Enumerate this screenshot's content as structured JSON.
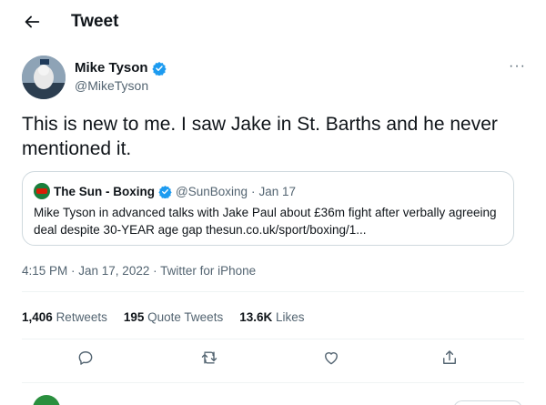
{
  "header": {
    "title": "Tweet"
  },
  "author": {
    "name": "Mike Tyson",
    "handle": "@MikeTyson"
  },
  "tweet": {
    "text": "This is new to me. I saw Jake in St. Barths and he never mentioned it."
  },
  "quote": {
    "name": "The Sun - Boxing",
    "handle": "@SunBoxing",
    "dot": "·",
    "date": "Jan 17",
    "body": "Mike Tyson in advanced talks with Jake Paul about £36m fight after verbally agreeing deal despite 30-YEAR age gap thesun.co.uk/sport/boxing/1..."
  },
  "meta": {
    "time": "4:15 PM · Jan 17, 2022",
    "separator": " · ",
    "source": "Twitter for iPhone"
  },
  "stats": {
    "retweets_count": "1,406",
    "retweets_label": "Retweets",
    "quotes_count": "195",
    "quotes_label": "Quote Tweets",
    "likes_count": "13.6K",
    "likes_label": "Likes"
  },
  "icons": {
    "back": "arrow-left-icon",
    "verified": "verified-badge-icon",
    "more": "more-icon",
    "reply": "reply-icon",
    "retweet": "retweet-icon",
    "like": "heart-icon",
    "share": "share-icon"
  },
  "colors": {
    "verified": "#1d9bf0",
    "text": "#0f1419",
    "secondary": "#536471",
    "border": "#cfd9de"
  }
}
